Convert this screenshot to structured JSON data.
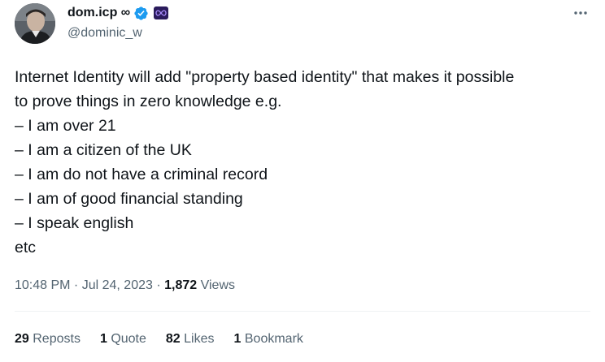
{
  "author": {
    "display_name": "dom.icp ∞",
    "handle": "@dominic_w",
    "verified": true,
    "affiliate_badge": "∞"
  },
  "tweet": {
    "lines": [
      "Internet Identity will add \"property based identity\" that makes it possible",
      "to prove things in zero knowledge e.g.",
      "– I am over 21",
      "– I am a citizen of the UK",
      "– I am do not have a criminal record",
      "– I am of good financial standing",
      "– I speak english",
      "etc"
    ]
  },
  "meta": {
    "time": "10:48 PM",
    "sep1": " · ",
    "date": "Jul 24, 2023",
    "sep2": " · ",
    "views_count": "1,872",
    "views_label": " Views"
  },
  "stats": {
    "reposts_count": "29",
    "reposts_label": "Reposts",
    "quotes_count": "1",
    "quotes_label": "Quote",
    "likes_count": "82",
    "likes_label": "Likes",
    "bookmarks_count": "1",
    "bookmarks_label": "Bookmark"
  },
  "colors": {
    "text_primary": "#0f1419",
    "text_secondary": "#536471",
    "verified_blue": "#1d9bf0",
    "divider": "#eff3f4"
  },
  "icons": {
    "verified": "verified-check-icon",
    "more": "more-options-icon",
    "affiliate": "infinity-badge-icon"
  }
}
